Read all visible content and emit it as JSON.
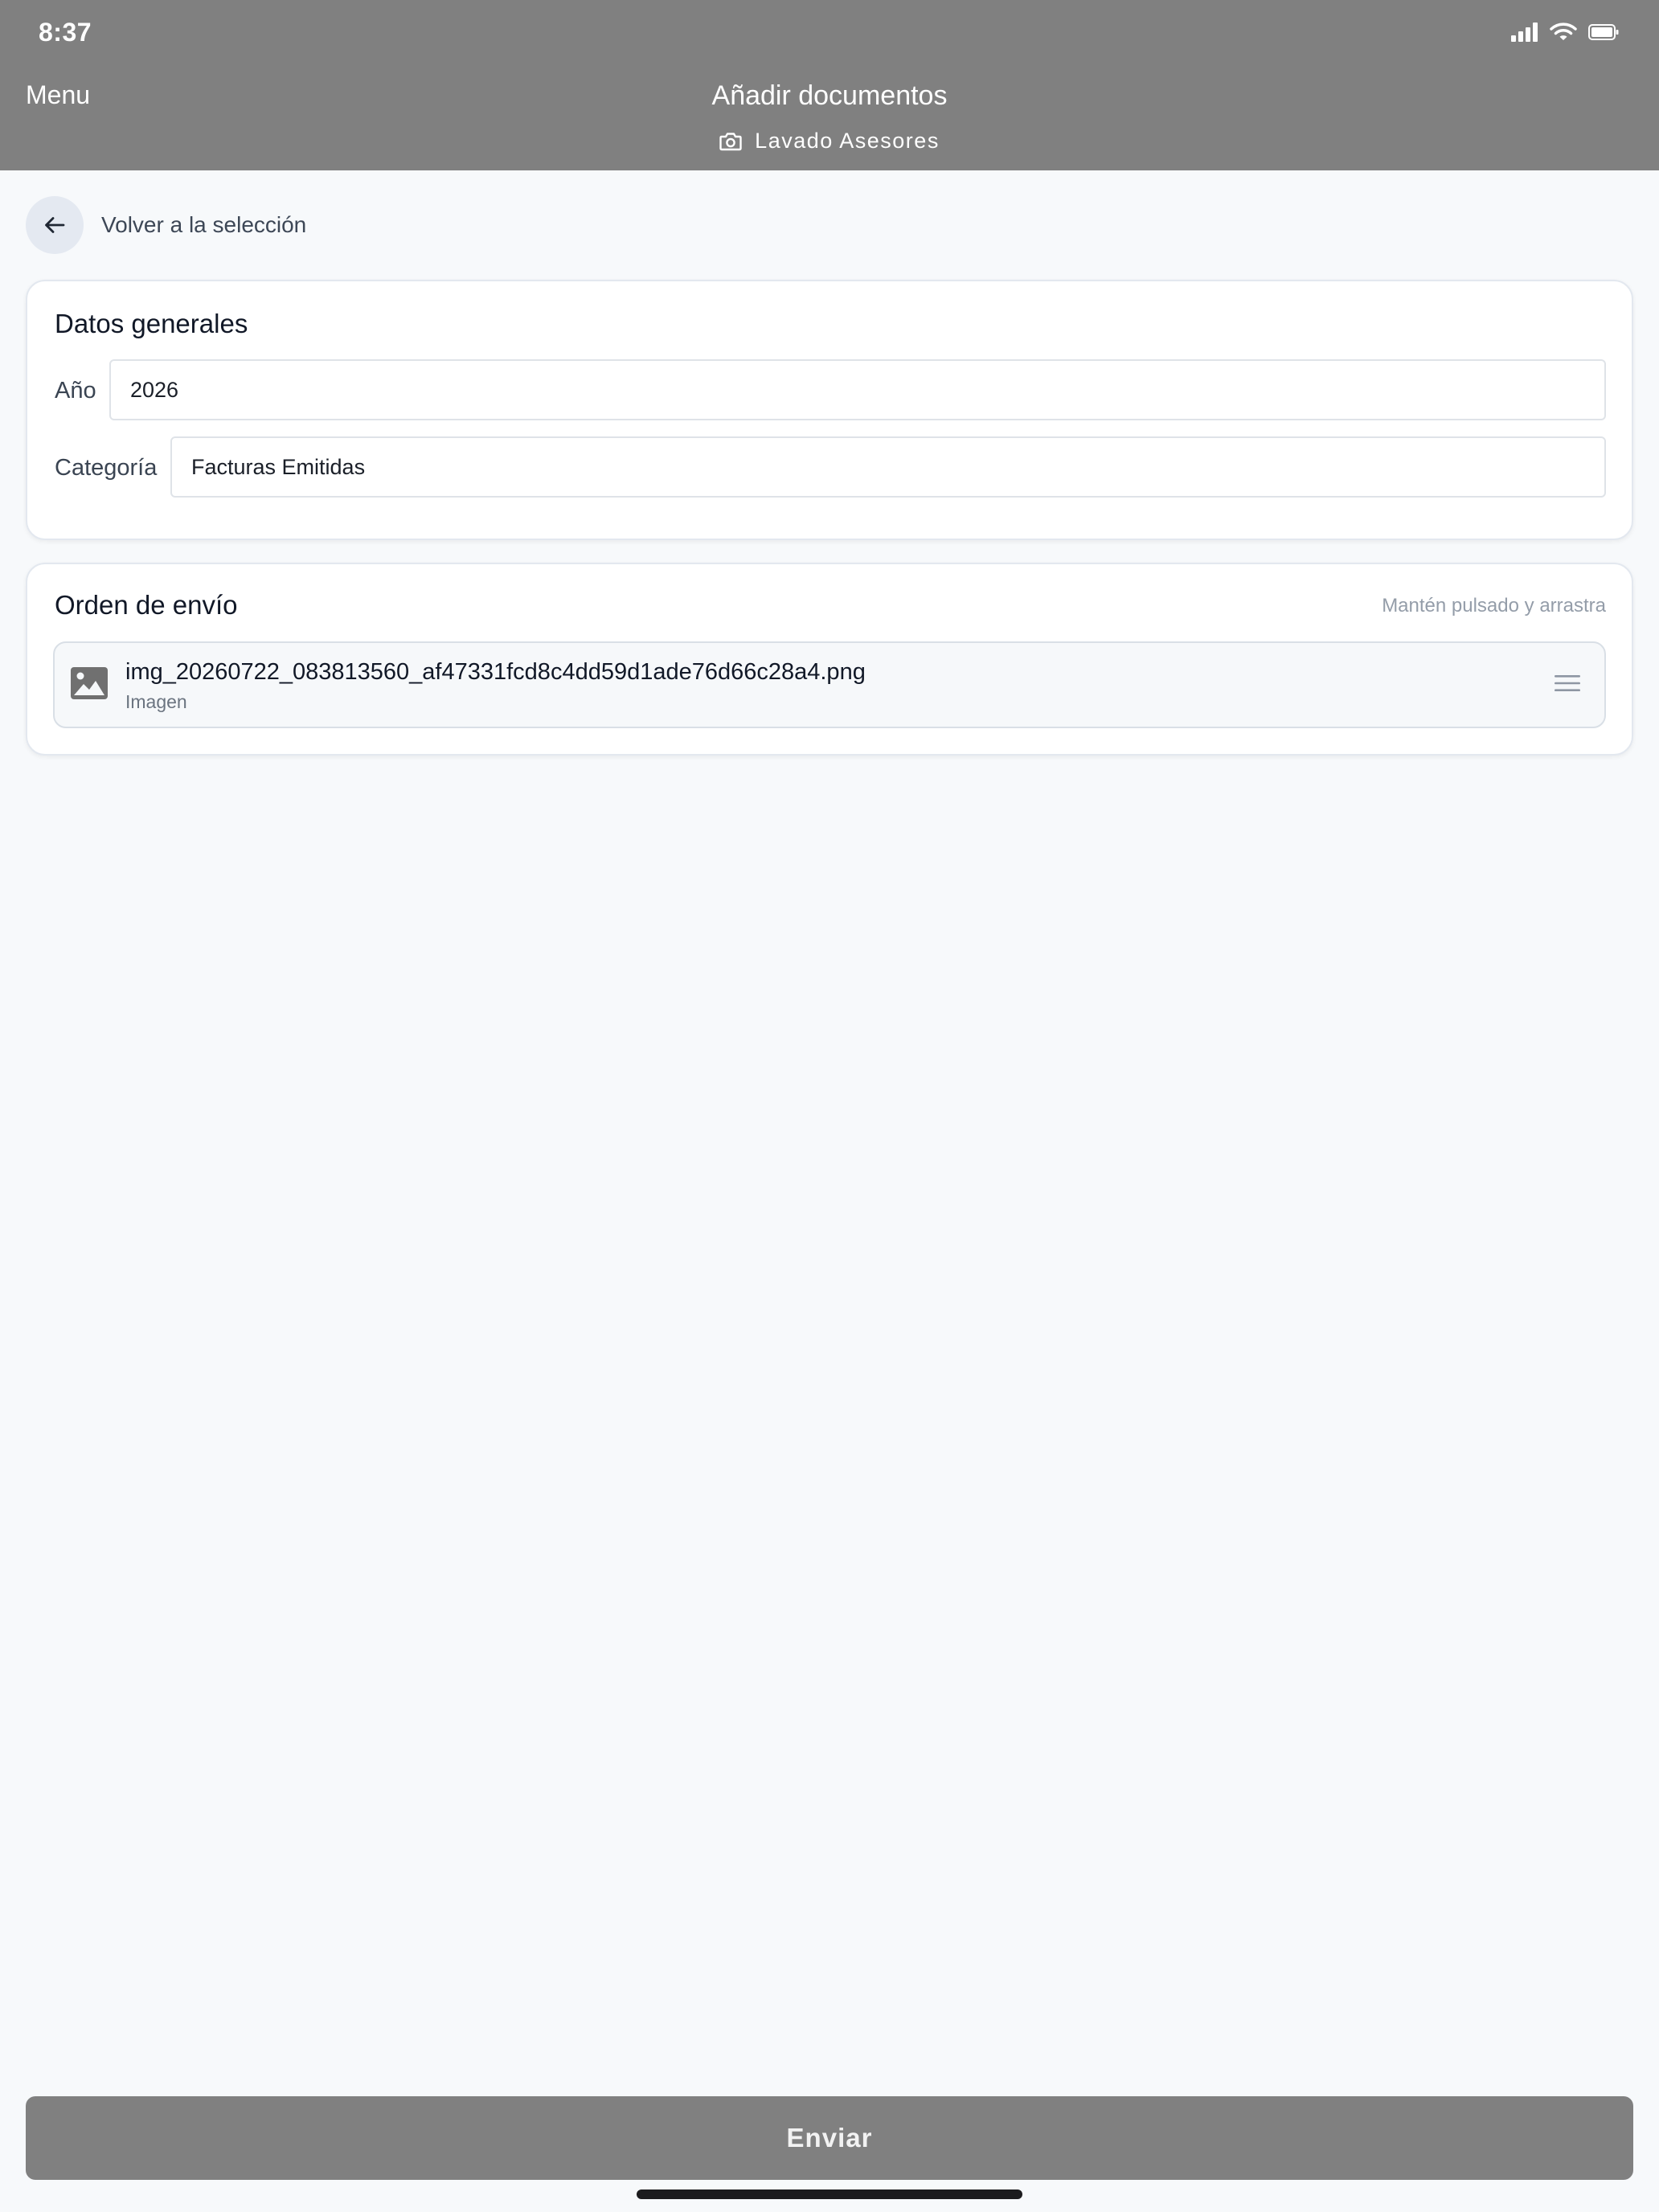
{
  "status_bar": {
    "time": "8:37",
    "icons": [
      "cellular-signal-icon",
      "wifi-icon",
      "battery-icon"
    ]
  },
  "header": {
    "menu_label": "Menu",
    "title": "Añadir documentos",
    "subtitle_icon": "camera-icon",
    "subtitle": "Lavado Asesores"
  },
  "back": {
    "icon": "arrow-left-icon",
    "label": "Volver a la selección"
  },
  "general_data": {
    "title": "Datos generales",
    "year_label": "Año",
    "year_value": "2026",
    "category_label": "Categoría",
    "category_value": "Facturas Emitidas"
  },
  "send_order": {
    "title": "Orden de envío",
    "hint": "Mantén pulsado y arrastra",
    "documents": [
      {
        "icon": "image-icon",
        "name": "img_20260722_083813560_af47331fcd8c4dd59d1ade76d66c28a4.png",
        "type": "Imagen",
        "handle_icon": "drag-handle-icon"
      }
    ]
  },
  "submit": {
    "label": "Enviar"
  },
  "colors": {
    "header_bg": "#808080",
    "page_bg": "#f7f9fb",
    "card_bg": "#ffffff",
    "button_bg": "#808080",
    "back_circle_bg": "#e4e9f1"
  }
}
